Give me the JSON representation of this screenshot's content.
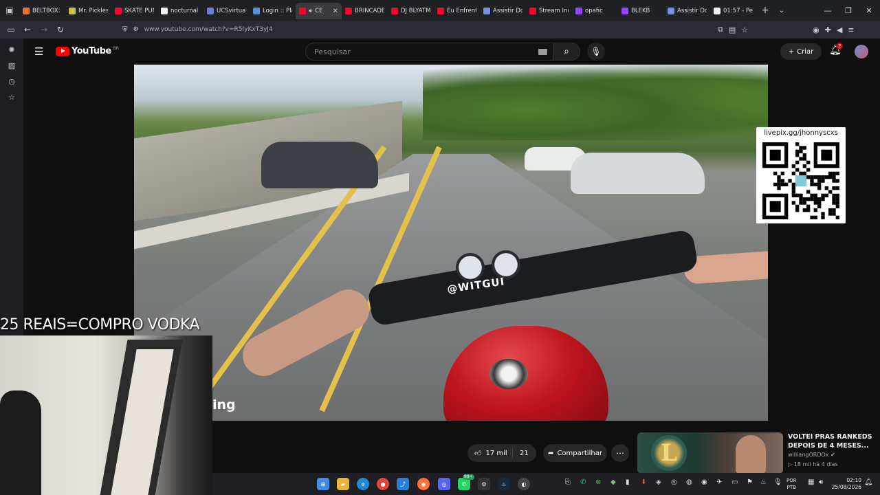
{
  "browser": {
    "tabs": [
      {
        "label": "BELTBOX: A",
        "color": "#f0703a",
        "active": false
      },
      {
        "label": "Mr. Pickles",
        "color": "#c7c24a",
        "active": false
      },
      {
        "label": "SKATE PUN",
        "color": "#ff0033",
        "active": false
      },
      {
        "label": "nocturnal",
        "color": "#f1f1f1",
        "active": false
      },
      {
        "label": "UCSvirtual",
        "color": "#6a7bd8",
        "active": false
      },
      {
        "label": "Login :: Pla",
        "color": "#5a8fd8",
        "active": false
      },
      {
        "label": "CE",
        "color": "#ff0033",
        "active": true
      },
      {
        "label": "BRINCADE",
        "color": "#ff0033",
        "active": false
      },
      {
        "label": "DJ BLYATM",
        "color": "#ff0033",
        "active": false
      },
      {
        "label": "Eu Enfrenti",
        "color": "#ff0033",
        "active": false
      },
      {
        "label": "Assistir Do",
        "color": "#7d8ee0",
        "active": false
      },
      {
        "label": "Stream Inc",
        "color": "#ff0033",
        "active": false
      },
      {
        "label": "opafic",
        "color": "#9147ff",
        "active": false
      },
      {
        "label": "BLEKB",
        "color": "#9147ff",
        "active": false
      },
      {
        "label": "Assistir Do",
        "color": "#7d8ee0",
        "active": false
      },
      {
        "label": "01:57 - Pe",
        "color": "#f1f1f1",
        "active": false
      }
    ],
    "url": "www.youtube.com/watch?v=R5IyKxT3yJ4"
  },
  "youtube": {
    "logo_text": "YouTube",
    "country": "BR",
    "search_placeholder": "Pesquisar",
    "create_label": "Criar",
    "notifications_count": "2"
  },
  "video": {
    "brand_sticker": "@WITGUI",
    "watermark": "ing",
    "qr_label": "livepix.gg/jhonnyscxs"
  },
  "stream_overlay": {
    "text": "25 REAIS=COMPRO VODKA"
  },
  "actions": {
    "likes": "17 mil",
    "dislikes": "21",
    "share_label": "Compartilhar"
  },
  "recommended": {
    "title": "VOLTEI PRAS RANKEDS DEPOIS DE 4 MESES...",
    "channel": "williangORDOx",
    "meta": "18 mil  há 4 dias"
  },
  "taskbar": {
    "lang_line1": "POR",
    "lang_line2": "PTB",
    "time": "02:10",
    "date": "25/08/2026",
    "badge_discord": "99+"
  }
}
